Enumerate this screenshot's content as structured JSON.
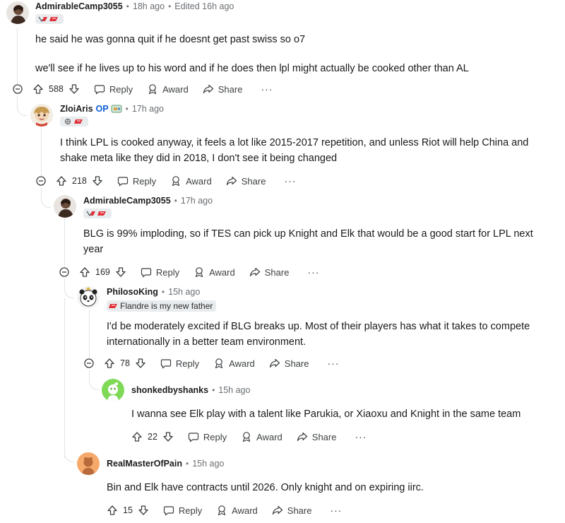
{
  "comments": [
    {
      "author": "AdmirableCamp3055",
      "time": "18h ago",
      "edited": "Edited 16h ago",
      "flair": "",
      "body": [
        "he said he was gonna quit if he doesnt get past swiss so o7",
        "we'll see if he lives up to his word and if he does then lpl might actually be cooked other than AL"
      ],
      "score": "588"
    },
    {
      "author": "ZloiAris",
      "op": "OP",
      "time": "17h ago",
      "flair": "",
      "body": [
        "I think LPL is cooked anyway, it feels a lot like 2015-2017 repetition, and unless Riot will help China and shake meta like they did in 2018, I don't see it being changed"
      ],
      "score": "218"
    },
    {
      "author": "AdmirableCamp3055",
      "time": "17h ago",
      "flair": "",
      "body": [
        "BLG is 99% imploding, so if TES can pick up Knight and Elk that would be a good start for LPL next year"
      ],
      "score": "169"
    },
    {
      "author": "PhilosoKing",
      "time": "15h ago",
      "flair": "Flandre is my new father",
      "body": [
        "I'd be moderately excited if BLG breaks up. Most of their players has what it takes to compete internationally in a better team environment."
      ],
      "score": "78"
    },
    {
      "author": "shonkedbyshanks",
      "time": "15h ago",
      "flair": "",
      "body": [
        "I wanna see Elk play with a talent like Parukia, or Xiaoxu and Knight in the same team"
      ],
      "score": "22"
    },
    {
      "author": "RealMasterOfPain",
      "time": "15h ago",
      "flair": "",
      "body": [
        "Bin and Elk have contracts until 2026. Only knight and on expiring iirc."
      ],
      "score": "15"
    }
  ],
  "actions": {
    "reply": "Reply",
    "award": "Award",
    "share": "Share",
    "more": "···"
  },
  "colors": {
    "op": "#0a5fd6",
    "thread_line": "#e0e3e6",
    "flair_bg": "#e9ecee",
    "flair_red": "#e0313a"
  },
  "icons": [
    "collapse-icon",
    "upvote-icon",
    "downvote-icon",
    "reply-icon",
    "award-icon",
    "share-icon",
    "more-icon"
  ]
}
